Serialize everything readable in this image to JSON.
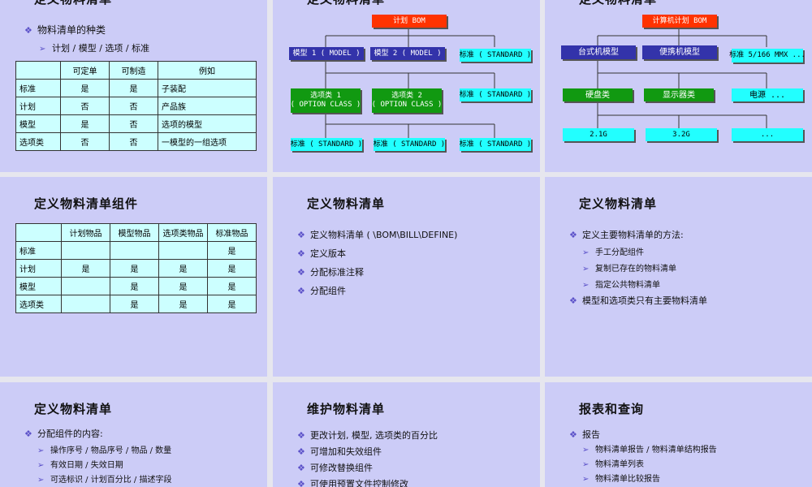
{
  "slides": {
    "s1": {
      "title": "定义物料清单",
      "bullet": "物料清单的种类",
      "sub": "计划 / 模型 / 选项 / 标准",
      "table": {
        "headers": [
          "",
          "可定单",
          "可制造",
          "例如"
        ],
        "rows": [
          [
            "标准",
            "是",
            "是",
            "子装配"
          ],
          [
            "计划",
            "否",
            "否",
            "产品族"
          ],
          [
            "模型",
            "是",
            "否",
            "选项的模型"
          ],
          [
            "选项类",
            "否",
            "否",
            "一模型的一组选项"
          ]
        ]
      }
    },
    "s2": {
      "title": "定义物料清单",
      "root": "计划 BOM",
      "row1": [
        "模型 1 ( MODEL )",
        "模型 2 ( MODEL )",
        "标准 ( STANDARD )"
      ],
      "row2a": "选项类 1",
      "row2a_b": "( OPTION CLASS )",
      "row2b": "选项类 2",
      "row2b_b": "( OPTION CLASS )",
      "row2c": "标准 ( STANDARD )",
      "row3": [
        "标准 ( STANDARD )",
        "标准 ( STANDARD )",
        "标准 ( STANDARD )"
      ]
    },
    "s3": {
      "title": "定义物料清单",
      "root": "计算机计划 BOM",
      "row1": [
        "台式机模型",
        "便携机模型",
        "标准 5/166 MMX ..."
      ],
      "row2": [
        "硬盘类",
        "显示器类",
        "电源 ..."
      ],
      "row3": [
        "2.1G",
        "3.2G",
        "..."
      ]
    },
    "s4": {
      "title": "定义物料清单组件",
      "table": {
        "headers": [
          "",
          "计划物品",
          "模型物品",
          "选项类物品",
          "标准物品"
        ],
        "rows": [
          [
            "标准",
            "",
            "",
            "",
            "是"
          ],
          [
            "计划",
            "是",
            "是",
            "是",
            "是"
          ],
          [
            "模型",
            "",
            "是",
            "是",
            "是"
          ],
          [
            "选项类",
            "",
            "是",
            "是",
            "是"
          ]
        ]
      }
    },
    "s5": {
      "title": "定义物料清单",
      "bullets": [
        "定义物料清单 ( \\BOM\\BILL\\DEFINE)",
        "定义版本",
        "分配标准注释",
        "分配组件"
      ]
    },
    "s6": {
      "title": "定义物料清单",
      "bullet1": "定义主要物料清单的方法:",
      "subs": [
        "手工分配组件",
        "复制已存在的物料清单",
        "指定公共物料清单"
      ],
      "bullet2": "模型和选项类只有主要物料清单"
    },
    "s7": {
      "title": "定义物料清单",
      "bullet": "分配组件的内容:",
      "subs": [
        "操作序号 / 物品序号 / 物品 / 数量",
        "有效日期 / 失效日期",
        "可选标识 / 计划百分比 / 描述字段"
      ]
    },
    "s8": {
      "title": "维护物料清单",
      "bullets": [
        "更改计划, 模型, 选项类的百分比",
        "可增加和失效组件",
        "可修改替换组件",
        "可使用预置文件控制修改"
      ]
    },
    "s9": {
      "title": "报表和查询",
      "bullet": "报告",
      "subs": [
        "物料清单报告 / 物料清单结构报告",
        "物料清单列表",
        "物料清单比较报告"
      ]
    }
  }
}
